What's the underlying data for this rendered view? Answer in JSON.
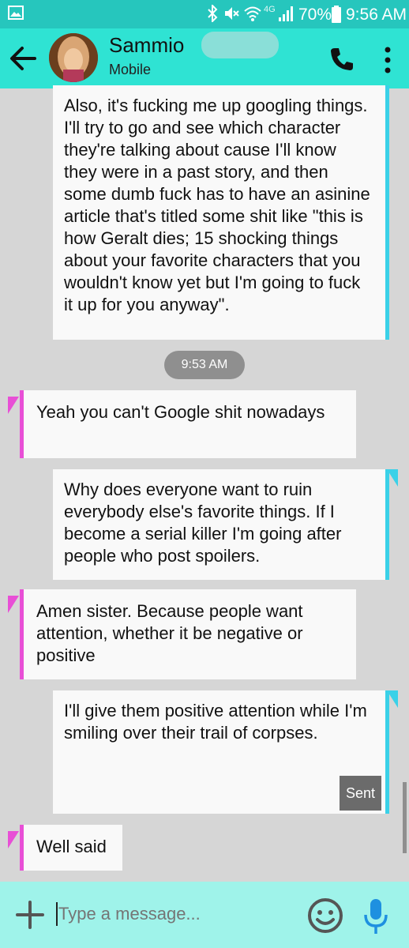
{
  "status_bar": {
    "battery": "70%",
    "time": "9:56 AM",
    "network": "4G"
  },
  "contact": {
    "name": "Sammio",
    "type": "Mobile"
  },
  "messages": [
    {
      "dir": "out",
      "text": "Also, it's fucking me up googling things. I'll try to go and see which character they're talking about cause I'll know they were in a past story, and then some dumb fuck has to have an asinine article that's titled some shit like \"this is how Geralt dies; 15 shocking things about your favorite characters that you wouldn't know yet but I'm going to fuck it up for you anyway\"."
    },
    {
      "dir": "time",
      "text": "9:53 AM"
    },
    {
      "dir": "in",
      "text": "Yeah you can't Google shit nowadays"
    },
    {
      "dir": "out",
      "text": "Why does everyone want to ruin everybody else's favorite things. If I become a serial killer I'm going after people who post spoilers."
    },
    {
      "dir": "in",
      "text": "Amen sister. Because people want attention, whether it be negative or positive"
    },
    {
      "dir": "out",
      "text": "I'll give them positive attention while I'm smiling over their trail of corpses.",
      "status": "Sent"
    },
    {
      "dir": "in",
      "text": "Well said"
    }
  ],
  "composer": {
    "placeholder": "Type a message..."
  },
  "colors": {
    "status_bar": "#26c6bd",
    "app_bar": "#2fe3d3",
    "input_bar": "#9ff3ea",
    "outgoing_accent": "#3ad1e8",
    "incoming_accent": "#e84fd6",
    "background": "#d6d6d6"
  }
}
